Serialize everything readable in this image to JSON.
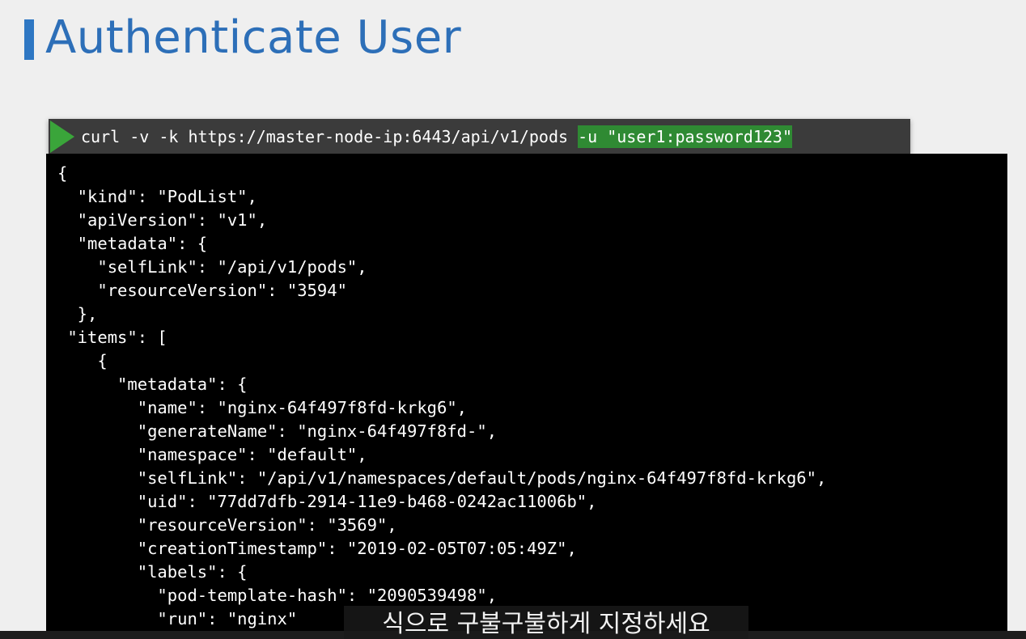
{
  "slide": {
    "title": "Authenticate User",
    "accent_color": "#2d6fb8",
    "prompt_icon": "play-triangle-icon"
  },
  "command": {
    "base": "curl -v -k https://master-node-ip:6443/api/v1/pods ",
    "highlighted": "-u \"user1:password123\"",
    "highlight_color": "#2f8a33"
  },
  "terminal": {
    "output": "{\n  \"kind\": \"PodList\",\n  \"apiVersion\": \"v1\",\n  \"metadata\": {\n    \"selfLink\": \"/api/v1/pods\",\n    \"resourceVersion\": \"3594\"\n  },\n \"items\": [\n    {\n      \"metadata\": {\n        \"name\": \"nginx-64f497f8fd-krkg6\",\n        \"generateName\": \"nginx-64f497f8fd-\",\n        \"namespace\": \"default\",\n        \"selfLink\": \"/api/v1/namespaces/default/pods/nginx-64f497f8fd-krkg6\",\n        \"uid\": \"77dd7dfb-2914-11e9-b468-0242ac11006b\",\n        \"resourceVersion\": \"3569\",\n        \"creationTimestamp\": \"2019-02-05T07:05:49Z\",\n        \"labels\": {\n          \"pod-template-hash\": \"2090539498\",\n          \"run\": \"nginx\""
  },
  "caption": {
    "text": "식으로 구불구불하게 지정하세요"
  }
}
